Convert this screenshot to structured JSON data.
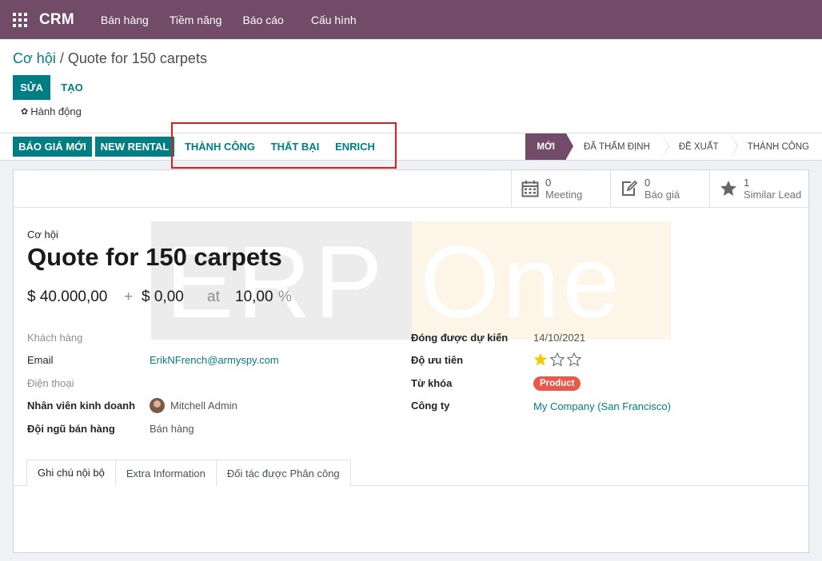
{
  "navbar": {
    "brand": "CRM",
    "menu": [
      "Bán hàng",
      "Tiềm năng",
      "Báo cáo",
      "Cấu hình"
    ],
    "bg_color": "#714b67"
  },
  "breadcrumb": {
    "parent": "Cơ hội",
    "separator": " / ",
    "current": "Quote for 150 carpets"
  },
  "buttons": {
    "edit": "SỬA",
    "create": "TẠO",
    "action": "Hành động"
  },
  "statusbar": {
    "new_quote": "BÁO GIÁ MỚI",
    "new_rental": "NEW RENTAL",
    "won": "THÀNH CÔNG",
    "lost": "THẤT BẠI",
    "enrich": "ENRICH",
    "stages": [
      "MỚI",
      "ĐÃ THẨM ĐỊNH",
      "ĐỀ XUẤT",
      "THÀNH CÔNG"
    ],
    "active_stage": "MỚI"
  },
  "smart_buttons": [
    {
      "icon": "calendar-icon",
      "count": "0",
      "label": "Meeting"
    },
    {
      "icon": "edit-icon",
      "count": "0",
      "label": "Báo giá"
    },
    {
      "icon": "star-icon",
      "count": "1",
      "label": "Similar Lead"
    }
  ],
  "watermark": {
    "left": "ERP",
    "right": "One"
  },
  "form": {
    "title_label": "Cơ hội",
    "title": "Quote for 150 carpets",
    "revenue": "$ 40.000,00",
    "plus": "+",
    "recurring": "$ 0,00",
    "at": "at",
    "probability": "10,00",
    "percent": "%",
    "left_fields": {
      "customer_label": "Khách hàng",
      "email_label": "Email",
      "email_value": "ErikNFrench@armyspy.com",
      "phone_label": "Điện thoại",
      "salesperson_label": "Nhân viên kinh doanh",
      "salesperson_value": "Mitchell Admin",
      "team_label": "Đội ngũ bán hàng",
      "team_value": "Bán hàng"
    },
    "right_fields": {
      "deadline_label": "Đóng được dự kiến",
      "deadline_value": "14/10/2021",
      "priority_label": "Độ ưu tiên",
      "priority_stars": 1,
      "priority_max": 3,
      "tags_label": "Từ khóa",
      "tag_value": "Product",
      "company_label": "Công ty",
      "company_value": "My Company (San Francisco)"
    }
  },
  "tabs": [
    "Ghi chú nội bộ",
    "Extra Information",
    "Đối tác được Phân công"
  ],
  "active_tab": "Ghi chú nội bộ"
}
